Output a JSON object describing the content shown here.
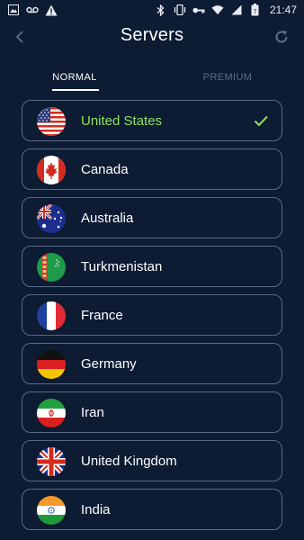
{
  "statusbar": {
    "time": "21:47"
  },
  "header": {
    "title": "Servers"
  },
  "tabs": {
    "normal": "NORMAL",
    "premium": "PREMIUM"
  },
  "servers": [
    {
      "name": "United States",
      "flag": "us-flag",
      "selected": true
    },
    {
      "name": "Canada",
      "flag": "ca-flag"
    },
    {
      "name": "Australia",
      "flag": "au-flag"
    },
    {
      "name": "Turkmenistan",
      "flag": "tm-flag"
    },
    {
      "name": "France",
      "flag": "fr-flag"
    },
    {
      "name": "Germany",
      "flag": "de-flag"
    },
    {
      "name": "Iran",
      "flag": "ir-flag"
    },
    {
      "name": "United Kingdom",
      "flag": "gb-flag"
    },
    {
      "name": "India",
      "flag": "in-flag"
    }
  ],
  "colors": {
    "background": "#0d1b33",
    "selected": "#8fe35c",
    "border": "#5b6a84",
    "inactive_tab": "#5e6e88"
  }
}
